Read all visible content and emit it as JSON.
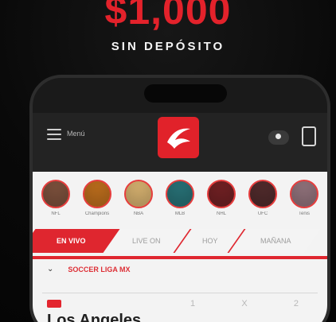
{
  "promo": {
    "headline": "$1,000",
    "subheadline": "SIN DEPÓSITO"
  },
  "app": {
    "menu_label": "Menú",
    "sections": {
      "live_label": "EN VIVO",
      "tab_2": "LIVE ON",
      "tab_3": "HOY",
      "tab_4": "MAÑANA"
    },
    "list_header": "SOCCER LIGA MX",
    "event_team": "Los Angeles"
  },
  "avatars": [
    {
      "label": "NFL",
      "color": "#7a4f3b"
    },
    {
      "label": "Champions",
      "color": "#b86b1c"
    },
    {
      "label": "NBA",
      "color": "#d1ad6d"
    },
    {
      "label": "MLB",
      "color": "#276f74"
    },
    {
      "label": "NHL",
      "color": "#6f2023"
    },
    {
      "label": "UFC",
      "color": "#4f2a2b"
    },
    {
      "label": "Tenis",
      "color": "#8e7079"
    }
  ],
  "odds": [
    "1",
    "X",
    "2"
  ],
  "colors": {
    "accent": "#df262f",
    "background": "#070707",
    "surface": "#f3f3f3"
  }
}
